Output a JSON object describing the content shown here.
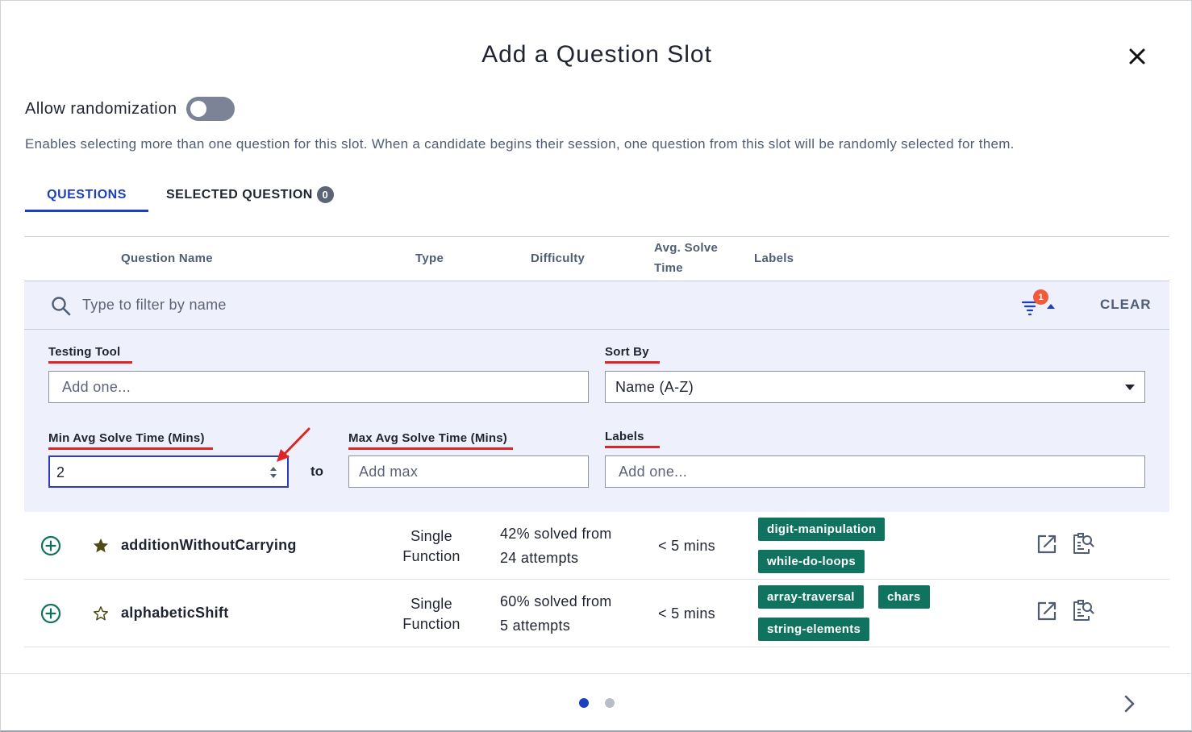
{
  "dialog": {
    "title": "Add a Question Slot"
  },
  "randomization": {
    "label": "Allow randomization",
    "enabled": false,
    "description": "Enables selecting more than one question for this slot. When a candidate begins their session, one question from this slot will be randomly selected for them."
  },
  "tabs": {
    "questions": "QUESTIONS",
    "selected": "SELECTED QUESTION",
    "selected_count": "0",
    "active": "questions"
  },
  "table": {
    "headers": {
      "name": "Question Name",
      "type": "Type",
      "difficulty": "Difficulty",
      "solve_time_line1": "Avg. Solve",
      "solve_time_line2": "Time",
      "labels": "Labels"
    }
  },
  "search": {
    "placeholder": "Type to filter by name",
    "filter_count": "1",
    "clear_label": "CLEAR"
  },
  "filters": {
    "testing_tool": {
      "label": "Testing Tool",
      "placeholder": "Add one..."
    },
    "sort_by": {
      "label": "Sort By",
      "value": "Name (A-Z)"
    },
    "min_solve": {
      "label": "Min Avg Solve Time (Mins)",
      "value": "2"
    },
    "to_label": "to",
    "max_solve": {
      "label": "Max Avg Solve Time (Mins)",
      "placeholder": "Add max"
    },
    "labels": {
      "label": "Labels",
      "placeholder": "Add one..."
    }
  },
  "questions": [
    {
      "name": "additionWithoutCarrying",
      "starred": true,
      "type_line1": "Single",
      "type_line2": "Function",
      "difficulty_line1": "42% solved from",
      "difficulty_line2": "24 attempts",
      "solve_time": "< 5 mins",
      "labels": [
        "digit-manipulation",
        "while-do-loops"
      ]
    },
    {
      "name": "alphabeticShift",
      "starred": false,
      "type_line1": "Single",
      "type_line2": "Function",
      "difficulty_line1": "60% solved from",
      "difficulty_line2": "5 attempts",
      "solve_time": "< 5 mins",
      "labels": [
        "array-traversal",
        "chars",
        "string-elements"
      ]
    }
  ],
  "pagination": {
    "pages": 2,
    "current": 1
  },
  "colors": {
    "accent_blue": "#1b3fbf",
    "tag_green": "#10735f",
    "annotation_red": "#e02424",
    "filter_badge": "#ef5b3b",
    "panel_bg": "#eef1fb"
  },
  "icons": {
    "close": "close-icon",
    "search": "search-icon",
    "filter": "filter-icon",
    "add": "plus-circle-icon",
    "star_filled": "star-filled-icon",
    "star_outline": "star-outline-icon",
    "open": "external-link-icon",
    "preview": "preview-icon",
    "next": "chevron-right-icon"
  }
}
